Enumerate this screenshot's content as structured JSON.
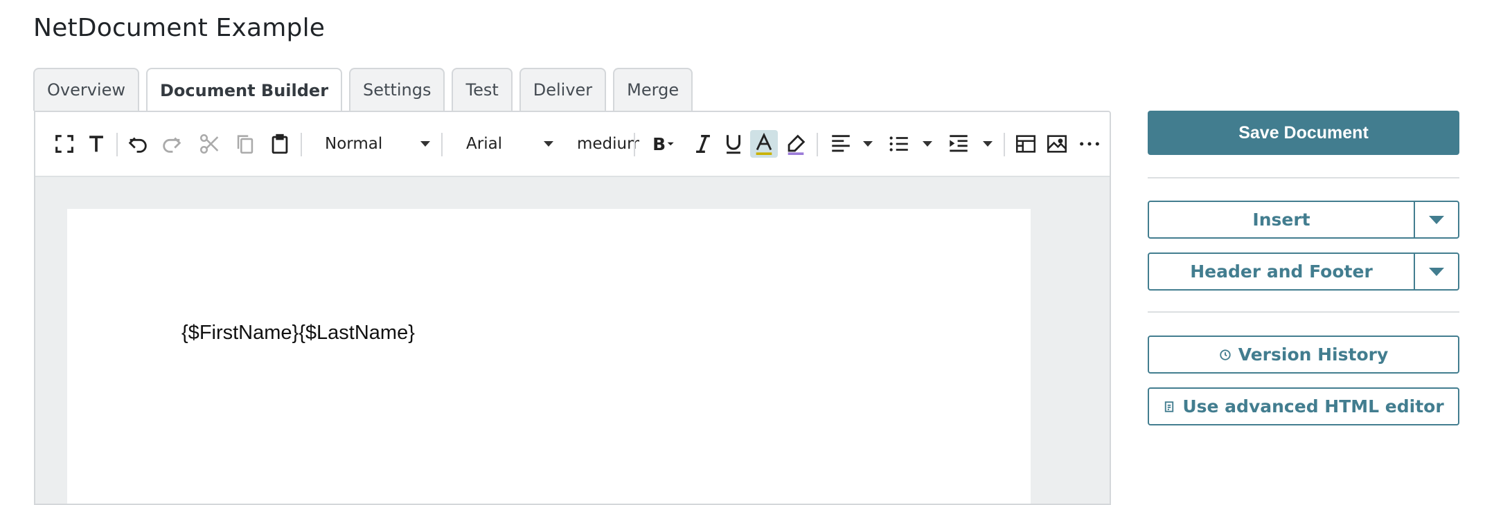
{
  "page": {
    "title": "NetDocument Example"
  },
  "tabs": [
    {
      "label": "Overview",
      "active": false
    },
    {
      "label": "Document Builder",
      "active": true
    },
    {
      "label": "Settings",
      "active": false
    },
    {
      "label": "Test",
      "active": false
    },
    {
      "label": "Deliver",
      "active": false
    },
    {
      "label": "Merge",
      "active": false
    }
  ],
  "toolbar": {
    "paragraph_style": "Normal",
    "font_family": "Arial",
    "font_size": "medium",
    "icons": [
      "fullscreen-icon",
      "text-format-icon",
      "undo-icon",
      "redo-icon",
      "cut-icon",
      "copy-icon",
      "paste-icon",
      "bold-icon",
      "italic-icon",
      "underline-icon",
      "font-color-icon",
      "highlight-icon",
      "align-left-icon",
      "bulleted-list-icon",
      "indent-icon",
      "table-icon",
      "image-icon",
      "more-icon"
    ]
  },
  "document": {
    "content": "{$FirstName}{$LastName}"
  },
  "sidebar": {
    "save_label": "Save Document",
    "insert_label": "Insert",
    "header_footer_label": "Header and Footer",
    "version_history_label": "Version History",
    "advanced_html_label": "Use advanced HTML editor"
  },
  "colors": {
    "accent": "#427d8f",
    "highlight_bg": "#cfe1e5",
    "editor_bg": "#eceeef"
  }
}
